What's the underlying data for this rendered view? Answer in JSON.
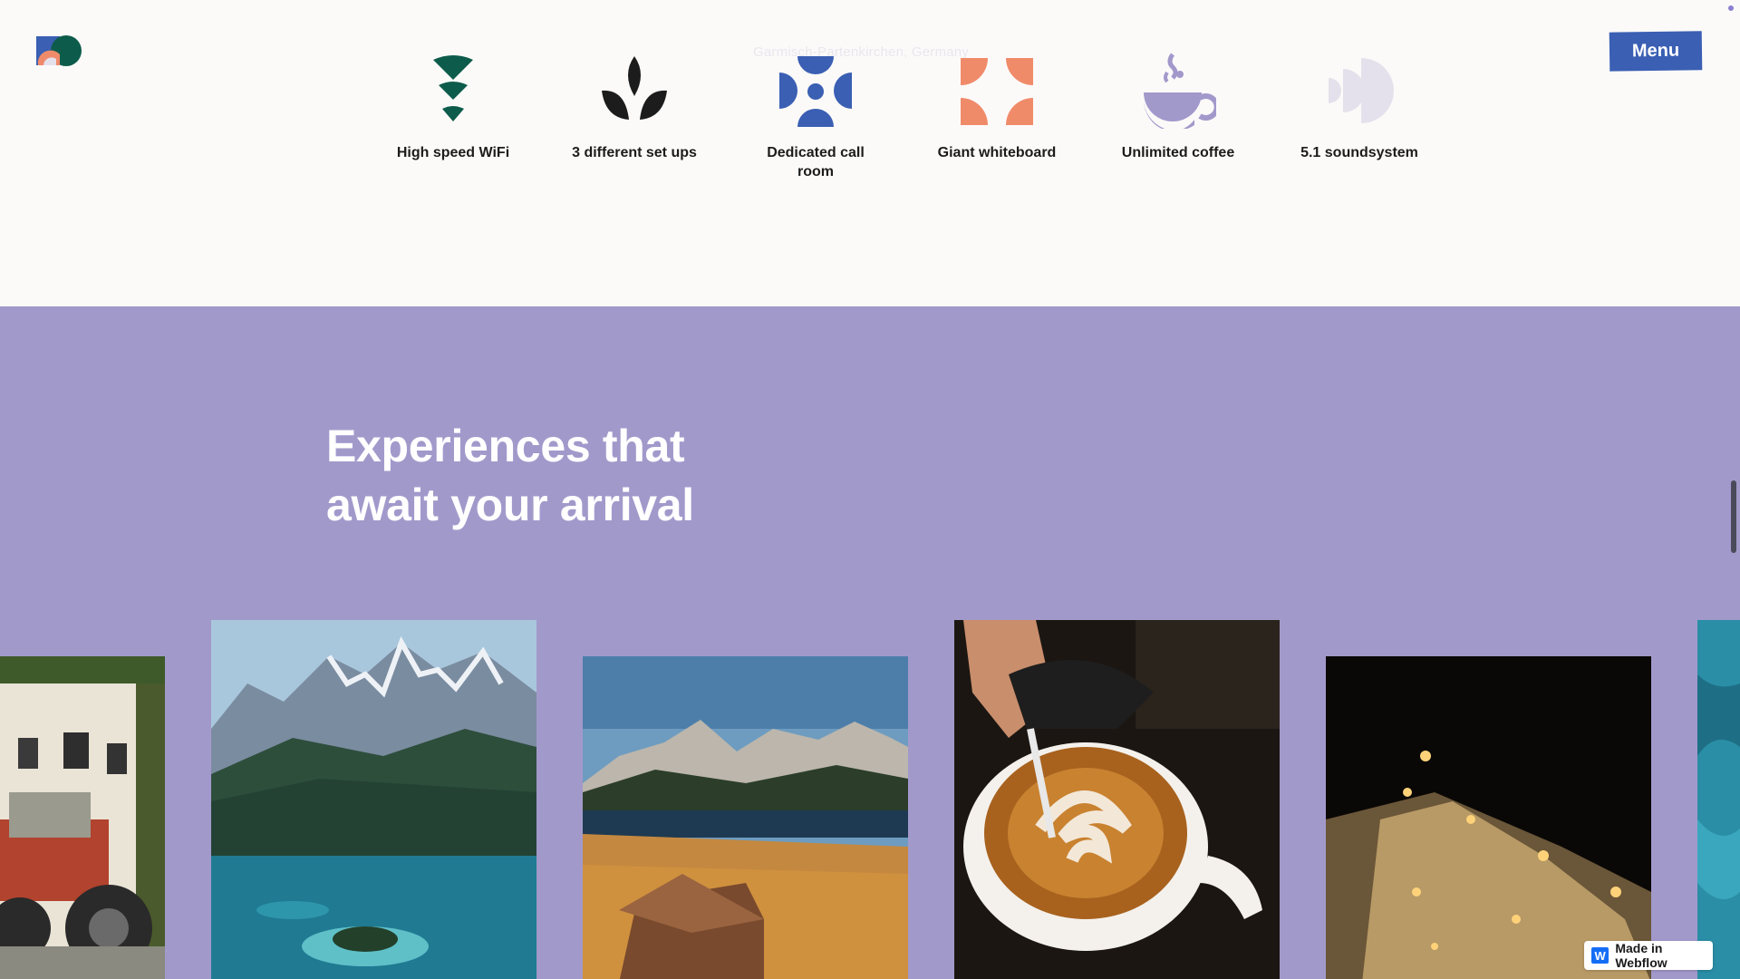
{
  "header": {
    "location": "Garmisch-Partenkirchen, Germany",
    "menu_label": "Menu"
  },
  "amenities": [
    {
      "label": "High speed WiFi",
      "icon": "wifi-icon",
      "color": "#0d5c4b"
    },
    {
      "label": "3 different set ups",
      "icon": "leaf-icon",
      "color": "#1c1c1c"
    },
    {
      "label": "Dedicated call room",
      "icon": "call-room-icon",
      "color": "#3a5fb3"
    },
    {
      "label": "Giant whiteboard",
      "icon": "whiteboard-icon",
      "color": "#f08b6a"
    },
    {
      "label": "Unlimited coffee",
      "icon": "coffee-icon",
      "color": "#a299cb"
    },
    {
      "label": "5.1 soundsystem",
      "icon": "speaker-icon",
      "color": "#e4e1ec"
    }
  ],
  "experiences": {
    "title": "Experiences that await your arrival",
    "photos": [
      {
        "name": "tractor-village-photo"
      },
      {
        "name": "alpine-lake-photo"
      },
      {
        "name": "mountain-meadow-photo"
      },
      {
        "name": "latte-art-photo"
      },
      {
        "name": "night-ski-slope-photo"
      },
      {
        "name": "turquoise-water-photo"
      }
    ]
  },
  "badge": {
    "label": "Made in Webflow"
  },
  "colors": {
    "accent": "#3a5fb3",
    "section_bg": "#a299cb",
    "page_bg": "#fcfaf9"
  }
}
